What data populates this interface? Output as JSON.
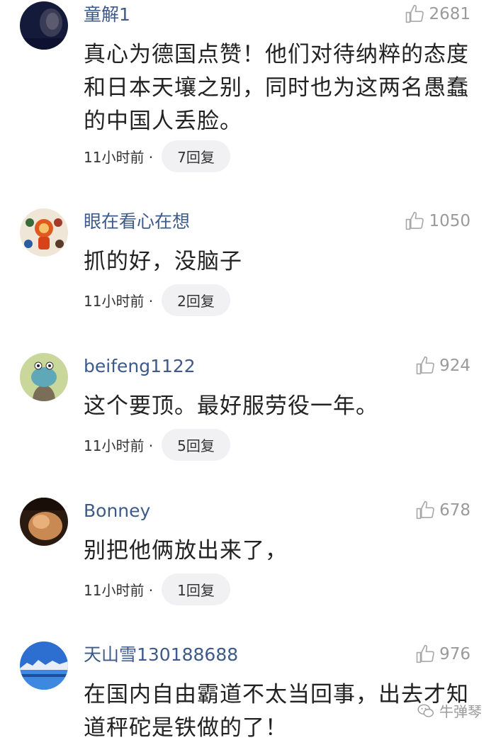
{
  "comments": [
    {
      "username": "童解1",
      "likes": "2681",
      "text": "真心为德国点赞！他们对待纳粹的态度和日本天壤之别，同时也为这两名愚蠢的中国人丢脸。",
      "time": "11小时前 ·",
      "replies": "7回复"
    },
    {
      "username": "眼在看心在想",
      "likes": "1050",
      "text": "抓的好，没脑子",
      "time": "11小时前 ·",
      "replies": "2回复"
    },
    {
      "username": "beifeng1122",
      "likes": "924",
      "text": "这个要顶。最好服劳役一年。",
      "time": "11小时前 ·",
      "replies": "5回复"
    },
    {
      "username": "Bonney",
      "likes": "678",
      "text": "别把他俩放出来了，",
      "time": "11小时前 ·",
      "replies": "1回复"
    },
    {
      "username": "天山雪130188688",
      "likes": "976",
      "text": "在国内自由霸道不太当回事，出去才知道秤砣是铁做的了！",
      "time": "",
      "replies": ""
    }
  ],
  "icons": {
    "like": "thumbs-up-icon",
    "watermark": "wechat-icon"
  },
  "colors": {
    "username": "#3d5a8a",
    "text": "#222222",
    "muted": "#9a9a9a",
    "reply_bg": "#f1f1f3"
  },
  "watermark": "牛弹琴"
}
